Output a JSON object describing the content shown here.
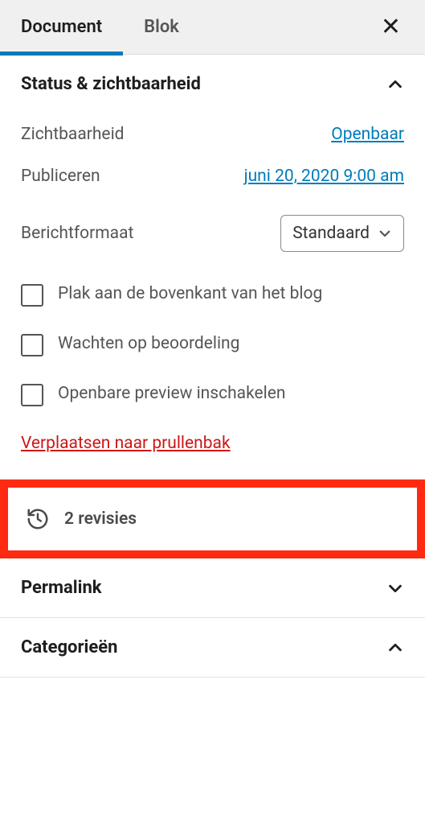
{
  "tabs": {
    "document": "Document",
    "block": "Blok"
  },
  "panels": {
    "status": {
      "title": "Status & zichtbaarheid",
      "visibility_label": "Zichtbaarheid",
      "visibility_value": "Openbaar",
      "publish_label": "Publiceren",
      "publish_value": "juni 20, 2020 9:00 am",
      "format_label": "Berichtformaat",
      "format_value": "Standaard",
      "sticky_label": "Plak aan de bovenkant van het blog",
      "pending_label": "Wachten op beoordeling",
      "public_preview_label": "Openbare preview inschakelen",
      "trash_label": "Verplaatsen naar prullenbak"
    },
    "revisions": {
      "label": "2 revisies"
    },
    "permalink": {
      "title": "Permalink"
    },
    "categories": {
      "title": "Categorieën"
    }
  }
}
